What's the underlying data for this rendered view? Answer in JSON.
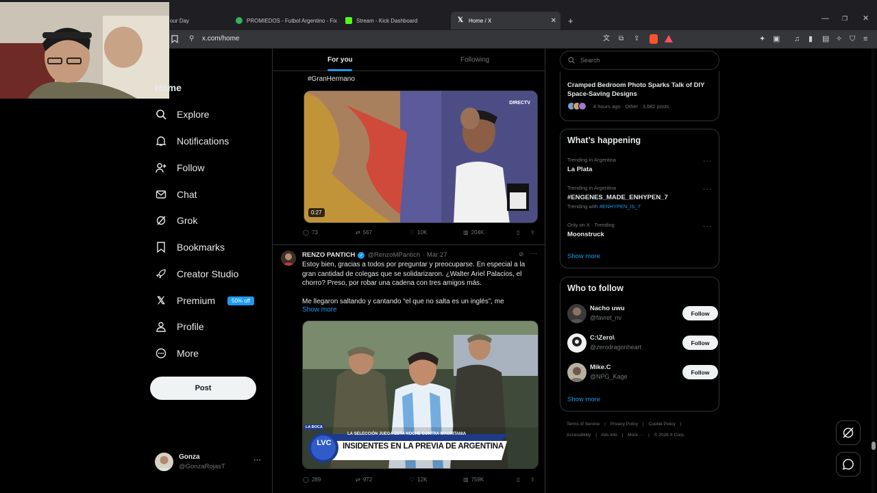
{
  "browser": {
    "tabs": [
      {
        "label": "our Day",
        "icon": "generic-tab-icon",
        "color": "#5f6368"
      },
      {
        "label": "PROMIEDOS - Futbol Argentino - Fixture",
        "icon": "promiedos-favicon",
        "color": "#35b15a"
      },
      {
        "label": "Stream - Kick Dashboard",
        "icon": "kick-favicon",
        "color": "#53fc18"
      },
      {
        "label": "Home / X",
        "icon": "x-favicon",
        "color": "#ffffff"
      }
    ],
    "new_tab": "+",
    "url": "x.com/home"
  },
  "nav": {
    "items": [
      {
        "label": "Home",
        "icon": "home-icon"
      },
      {
        "label": "Explore",
        "icon": "search-icon"
      },
      {
        "label": "Notifications",
        "icon": "bell-icon"
      },
      {
        "label": "Follow",
        "icon": "person-add-icon"
      },
      {
        "label": "Chat",
        "icon": "mail-icon"
      },
      {
        "label": "Grok",
        "icon": "grok-icon"
      },
      {
        "label": "Bookmarks",
        "icon": "bookmark-icon"
      },
      {
        "label": "Creator Studio",
        "icon": "rocket-icon"
      },
      {
        "label": "Premium",
        "icon": "x-logo-icon"
      },
      {
        "label": "Profile",
        "icon": "person-icon"
      },
      {
        "label": "More",
        "icon": "more-circle-icon"
      }
    ],
    "premium_badge": "50% off",
    "post_label": "Post"
  },
  "account": {
    "name": "Gonza",
    "handle": "@GonzaRojasT",
    "menu": "···"
  },
  "feed": {
    "tabs": [
      "For you",
      "Following"
    ],
    "tweet1": {
      "hashtag": "#GranHermano",
      "video_duration": "0:27",
      "watermark": "DIRECTV",
      "stats": {
        "replies": "73",
        "reposts": "567",
        "likes": "10K",
        "views": "204K"
      }
    },
    "tweet2": {
      "author": "RENZO PANTICH",
      "handle": "@RenzoMPantich",
      "date": "· Mar 27",
      "text": "Estoy bien, gracias a todos por preguntar y preocuparse. En especial a la gran cantidad de colegas que se solidarizaron. ¿Walter Ariel Palacios, el chorro? Preso, por robar una cadena con tres amigos más.",
      "text2": "Me llegaron saltando y cantando “el que no salta es un inglés”, me",
      "show_more": "Show more",
      "image_ticker": "LA SELECCIÓN JUEGA ESTA NOCHE CONTRA MAURITANIA",
      "image_headline": "INSIDENTES EN LA PREVIA DE ARGENTINA",
      "image_logo": "LVC",
      "image_tag": "LA BOCA",
      "stats": {
        "replies": "289",
        "reposts": "972",
        "likes": "12K",
        "views": "759K"
      }
    }
  },
  "right": {
    "search_placeholder": "Search",
    "news": {
      "title": "Cramped Bedroom Photo Sparks Talk of DIY Space-Saving Designs",
      "meta": "4 hours ago · Other · 3,682 posts"
    },
    "happening": {
      "title": "What’s happening",
      "trends": [
        {
          "context": "Trending in Argentina",
          "name": "La Plata"
        },
        {
          "context": "Trending in Argentina",
          "name": "#ENGENES_MADE_ENHYPEN_7",
          "with_label": "Trending with",
          "with_tag": "#ENHYPEN_IS_7"
        },
        {
          "context": "Only on X · Trending",
          "name": "Moonstruck"
        }
      ],
      "show_more": "Show more"
    },
    "who_to_follow": {
      "title": "Who to follow",
      "people": [
        {
          "name": "Nacho uwu",
          "handle": "@favret_nv",
          "button": "Follow"
        },
        {
          "name": "C:\\Zero\\",
          "handle": "@zerodragonheart",
          "button": "Follow"
        },
        {
          "name": "Mike.C",
          "handle": "@NPG_Kage",
          "button": "Follow"
        }
      ],
      "show_more": "Show more"
    },
    "footer": {
      "line1": [
        "Terms of Service",
        "Privacy Policy",
        "Cookie Policy"
      ],
      "line2": [
        "Accessibility",
        "Ads info",
        "More ···",
        "© 2026 X Corp."
      ]
    }
  },
  "colors": {
    "accent": "#1d9bf0",
    "background": "#000000",
    "border": "#2f3336",
    "muted": "#71767b"
  }
}
